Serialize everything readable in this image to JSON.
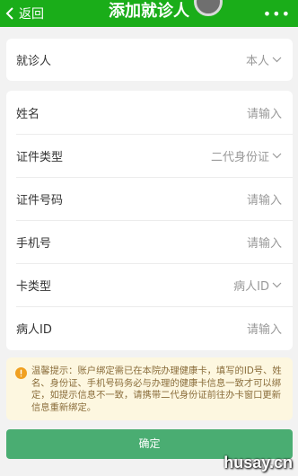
{
  "nav": {
    "back_label": "返回",
    "title": "添加就诊人",
    "more_label": "•••",
    "bar_color": "#1aad19"
  },
  "patient_selector": {
    "label": "就诊人",
    "value": "本人",
    "icon": "chevron-down-icon"
  },
  "form": {
    "rows": [
      {
        "label": "姓名",
        "value": "请输入",
        "kind": "input"
      },
      {
        "label": "证件类型",
        "value": "二代身份证",
        "kind": "select"
      },
      {
        "label": "证件号码",
        "value": "请输入",
        "kind": "input"
      },
      {
        "label": "手机号",
        "value": "请输入",
        "kind": "input"
      },
      {
        "label": "卡类型",
        "value": "病人ID",
        "kind": "select"
      },
      {
        "label": "病人ID",
        "value": "请输入",
        "kind": "input"
      }
    ]
  },
  "notice": {
    "icon": "warning-icon",
    "text": "温馨提示：账户绑定需已在本院办理健康卡，填写的ID号、姓名、身份证、手机号码务必与办理的健康卡信息一致才可以绑定，如提示信息不一致，请携带二代身份证前往办卡窗口更新信息重新绑定。"
  },
  "confirm_button": {
    "label": "确定",
    "color": "#4aad72"
  },
  "watermark": "husay.cn"
}
